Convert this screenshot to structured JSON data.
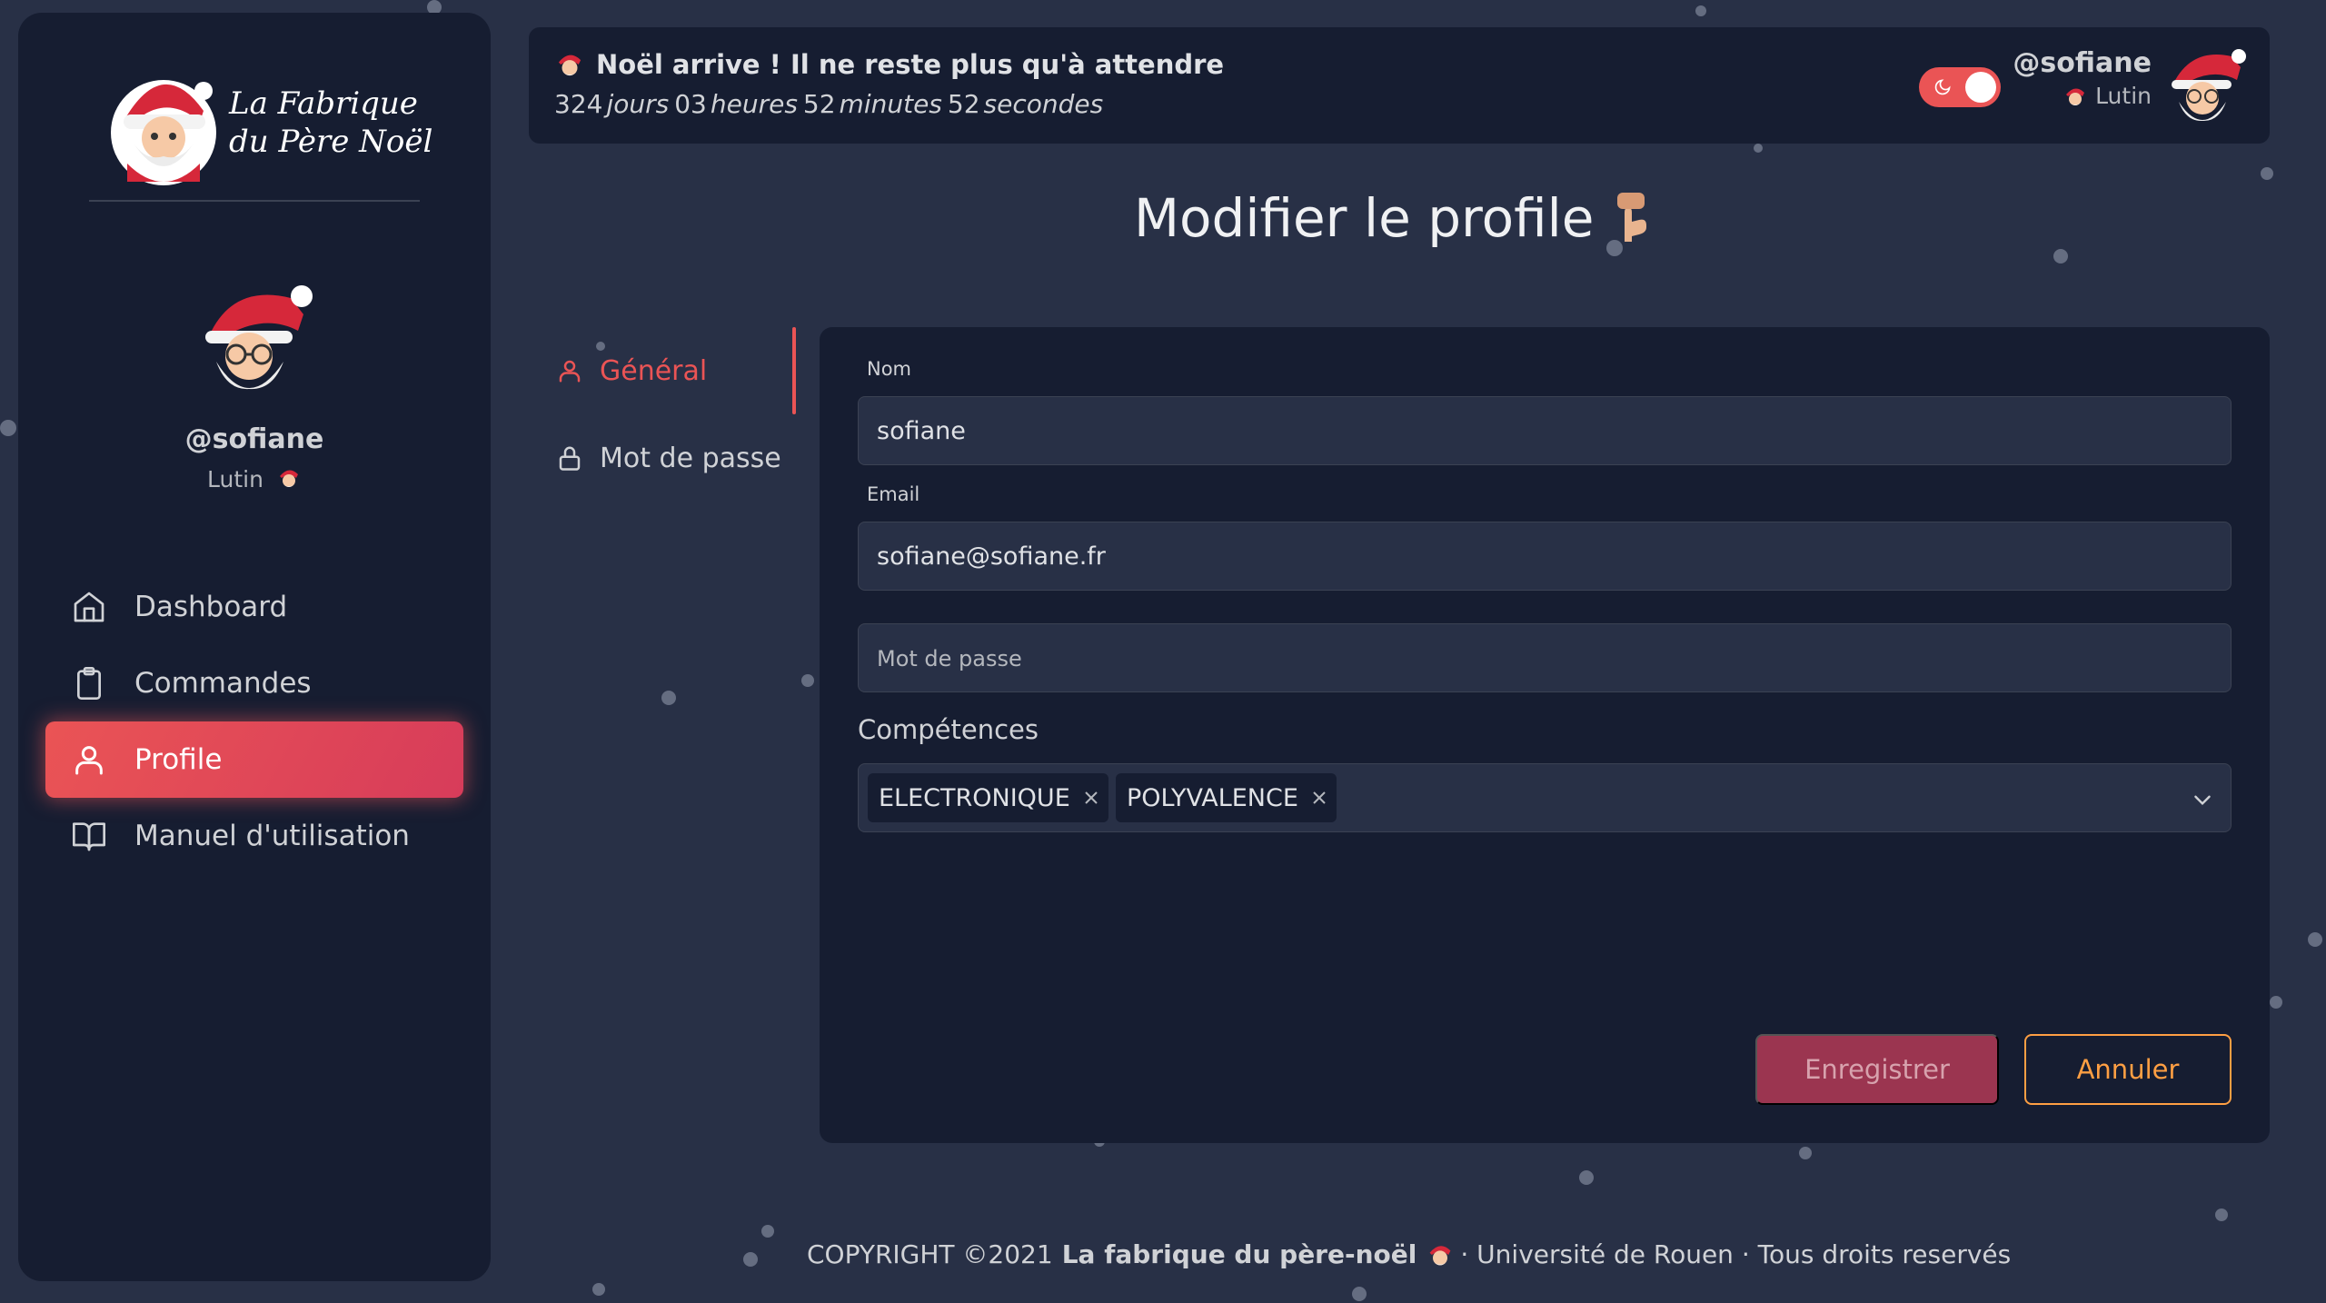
{
  "brand": {
    "line1": "La Fabrique",
    "line2": "du Père Noël"
  },
  "sidebar_profile": {
    "username": "@sofiane",
    "role": "Lutin"
  },
  "nav": {
    "items": [
      {
        "label": "Dashboard",
        "icon": "home-icon"
      },
      {
        "label": "Commandes",
        "icon": "clipboard-icon"
      },
      {
        "label": "Profile",
        "icon": "user-icon",
        "active": true
      },
      {
        "label": "Manuel d'utilisation",
        "icon": "book-icon"
      }
    ]
  },
  "countdown": {
    "title": "Noël arrive ! Il ne reste plus qu'à attendre",
    "days": "324",
    "days_unit": "jours",
    "hours": "03",
    "hours_unit": "heures",
    "minutes": "52",
    "minutes_unit": "minutes",
    "seconds": "52",
    "seconds_unit": "secondes"
  },
  "topbar_user": {
    "username": "@sofiane",
    "role": "Lutin",
    "theme_toggle": "dark-mode-on"
  },
  "page": {
    "title": "Modifier le profile"
  },
  "tabs": [
    {
      "label": "Général",
      "icon": "user-icon",
      "active": true
    },
    {
      "label": "Mot de passe",
      "icon": "lock-icon",
      "active": false
    }
  ],
  "form": {
    "name_label": "Nom",
    "name_value": "sofiane",
    "email_label": "Email",
    "email_value": "sofiane@sofiane.fr",
    "password_placeholder": "Mot de passe",
    "skills_label": "Compétences",
    "skills": [
      "ELECTRONIQUE",
      "POLYVALENCE"
    ],
    "save_label": "Enregistrer",
    "cancel_label": "Annuler"
  },
  "footer": {
    "prefix": "COPYRIGHT ©2021",
    "brand": "La fabrique du père-noël",
    "suffix": "· Université de Rouen · Tous droits reservés"
  },
  "colors": {
    "background": "#283046",
    "panel": "#161d31",
    "accent": "#ea5455",
    "cancel": "#ff9f43"
  }
}
